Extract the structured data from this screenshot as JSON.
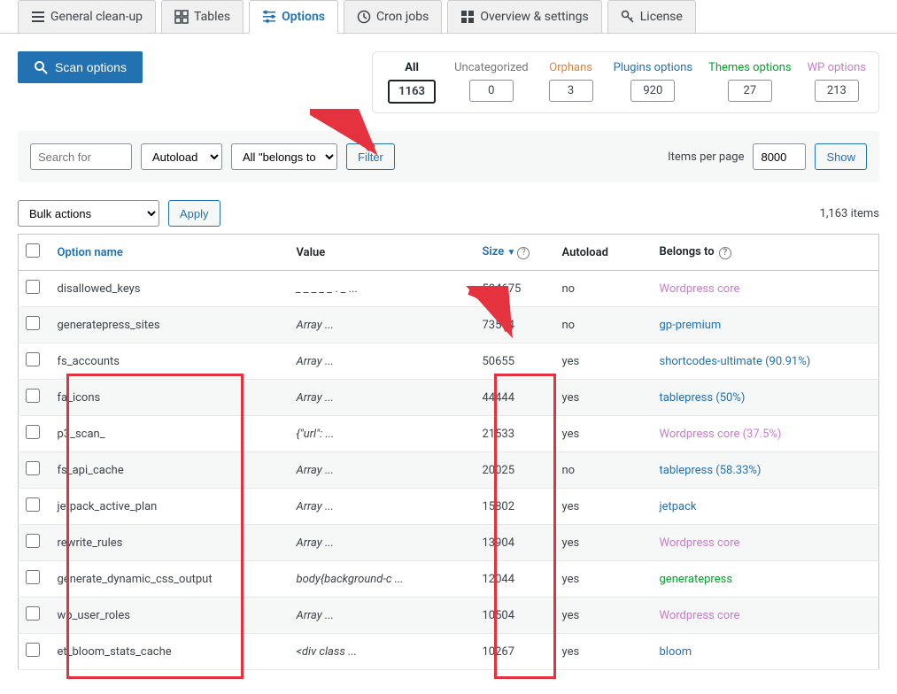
{
  "tabs": [
    {
      "label": "General clean-up"
    },
    {
      "label": "Tables"
    },
    {
      "label": "Options"
    },
    {
      "label": "Cron jobs"
    },
    {
      "label": "Overview & settings"
    },
    {
      "label": "License"
    }
  ],
  "scan_button": "Scan options",
  "stats": {
    "all": {
      "label": "All",
      "value": "1163"
    },
    "uncategorized": {
      "label": "Uncategorized",
      "value": "0"
    },
    "orphans": {
      "label": "Orphans",
      "value": "3"
    },
    "plugins": {
      "label": "Plugins options",
      "value": "920"
    },
    "themes": {
      "label": "Themes options",
      "value": "27"
    },
    "wp": {
      "label": "WP options",
      "value": "213"
    }
  },
  "filters": {
    "search_placeholder": "Search for",
    "autoload_placeholder": "Autoload",
    "belongs_placeholder": "All \"belongs to\"",
    "filter_btn": "Filter",
    "ipp_label": "Items per page",
    "ipp_value": "8000",
    "show_btn": "Show"
  },
  "bulk": {
    "placeholder": "Bulk actions",
    "apply": "Apply",
    "count": "1,163 items"
  },
  "columns": {
    "name": "Option name",
    "value": "Value",
    "size": "Size",
    "autoload": "Autoload",
    "belongs": "Belongs to"
  },
  "rows": [
    {
      "name": "disallowed_keys",
      "value": "_ _ _ _ _ . _ ...",
      "size": "584675",
      "autoload": "no",
      "belongs": "Wordpress core",
      "belongs_class": "link-violet"
    },
    {
      "name": "generatepress_sites",
      "value": "Array ...",
      "size": "73554",
      "autoload": "no",
      "belongs": "gp-premium",
      "belongs_class": "link-blue"
    },
    {
      "name": "fs_accounts",
      "value": "Array ...",
      "size": "50655",
      "autoload": "yes",
      "belongs": "shortcodes-ultimate (90.91%)",
      "belongs_class": "link-blue"
    },
    {
      "name": "fa_icons",
      "value": "Array ...",
      "size": "44444",
      "autoload": "yes",
      "belongs": "tablepress (50%)",
      "belongs_class": "link-blue"
    },
    {
      "name": "p3_scan_",
      "value": "{\"url\": ...",
      "size": "21533",
      "autoload": "yes",
      "belongs": "Wordpress core (37.5%)",
      "belongs_class": "link-violet"
    },
    {
      "name": "fs_api_cache",
      "value": "Array ...",
      "size": "20025",
      "autoload": "no",
      "belongs": "tablepress (58.33%)",
      "belongs_class": "link-blue"
    },
    {
      "name": "jetpack_active_plan",
      "value": "Array ...",
      "size": "15802",
      "autoload": "yes",
      "belongs": "jetpack",
      "belongs_class": "link-blue"
    },
    {
      "name": "rewrite_rules",
      "value": "Array ...",
      "size": "13904",
      "autoload": "yes",
      "belongs": "Wordpress core",
      "belongs_class": "link-violet"
    },
    {
      "name": "generate_dynamic_css_output",
      "value": "body{background-c ...",
      "size": "12044",
      "autoload": "yes",
      "belongs": "generatepress",
      "belongs_class": "link-green"
    },
    {
      "name": "wp_user_roles",
      "value": "Array ...",
      "size": "10504",
      "autoload": "yes",
      "belongs": "Wordpress core",
      "belongs_class": "link-violet"
    },
    {
      "name": "et_bloom_stats_cache",
      "value": "<div class ...",
      "size": "10267",
      "autoload": "yes",
      "belongs": "bloom",
      "belongs_class": "link-blue"
    }
  ]
}
